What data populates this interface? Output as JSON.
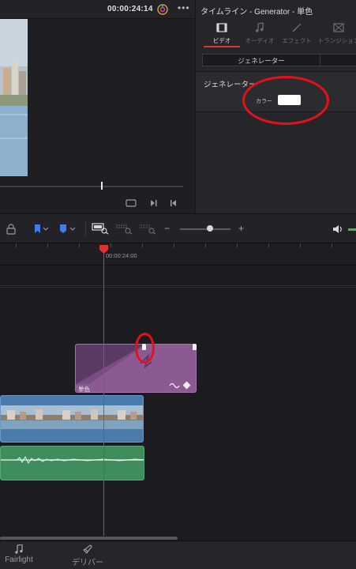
{
  "viewer": {
    "timecode": "00:00:24:14",
    "more": "•••"
  },
  "inspector": {
    "title": "タイムライン - Generator - 単色",
    "tabs": [
      {
        "label": "ビデオ",
        "icon": "film-icon",
        "active": true
      },
      {
        "label": "オーディオ",
        "icon": "music-note-icon",
        "active": false
      },
      {
        "label": "エフェクト",
        "icon": "magic-wand-icon",
        "active": false
      },
      {
        "label": "トランジション",
        "icon": "transition-icon",
        "active": false
      }
    ],
    "generator_header": "ジェネレーター",
    "generator_section_title": "ジェネレーター",
    "color_label": "カラー",
    "color_value": "#ffffff"
  },
  "timeline": {
    "ruler_time": "00:00:24:00",
    "generator_clip_label": "単色"
  },
  "bottom_tabs": [
    {
      "label": "Fairlight",
      "icon": "music-note-icon"
    },
    {
      "label": "デリバー",
      "icon": "rocket-icon"
    }
  ],
  "colors": {
    "playhead": "#e0322c",
    "annotation": "#e3121a",
    "generator_clip": "#8b5a93",
    "video_clip": "#4b7bab",
    "audio_clip": "#3f8c5d",
    "active_tab_underline": "#d23a36"
  }
}
